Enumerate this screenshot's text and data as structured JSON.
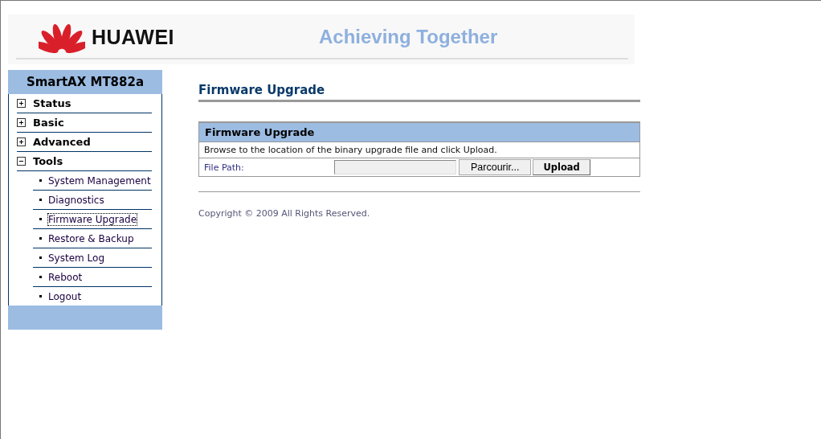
{
  "header": {
    "brand": "HUAWEI",
    "slogan": "Achieving Together"
  },
  "sidebar": {
    "title": "SmartAX MT882a",
    "items": [
      {
        "label": "Status",
        "expanded": false
      },
      {
        "label": "Basic",
        "expanded": false
      },
      {
        "label": "Advanced",
        "expanded": false
      },
      {
        "label": "Tools",
        "expanded": true,
        "children": [
          {
            "label": "System Management",
            "selected": false
          },
          {
            "label": "Diagnostics",
            "selected": false
          },
          {
            "label": "Firmware Upgrade",
            "selected": true
          },
          {
            "label": "Restore & Backup",
            "selected": false
          },
          {
            "label": "System Log",
            "selected": false
          },
          {
            "label": "Reboot",
            "selected": false
          },
          {
            "label": "Logout",
            "selected": false
          }
        ]
      }
    ]
  },
  "page_title": "Firmware Upgrade",
  "panel": {
    "title": "Firmware Upgrade",
    "instruction": "Browse to the location of the binary upgrade file and click Upload.",
    "field_label": "File Path:",
    "browse_button": "Parcourir...",
    "upload_button": "Upload"
  },
  "footer": "Copyright © 2009 All Rights Reserved."
}
